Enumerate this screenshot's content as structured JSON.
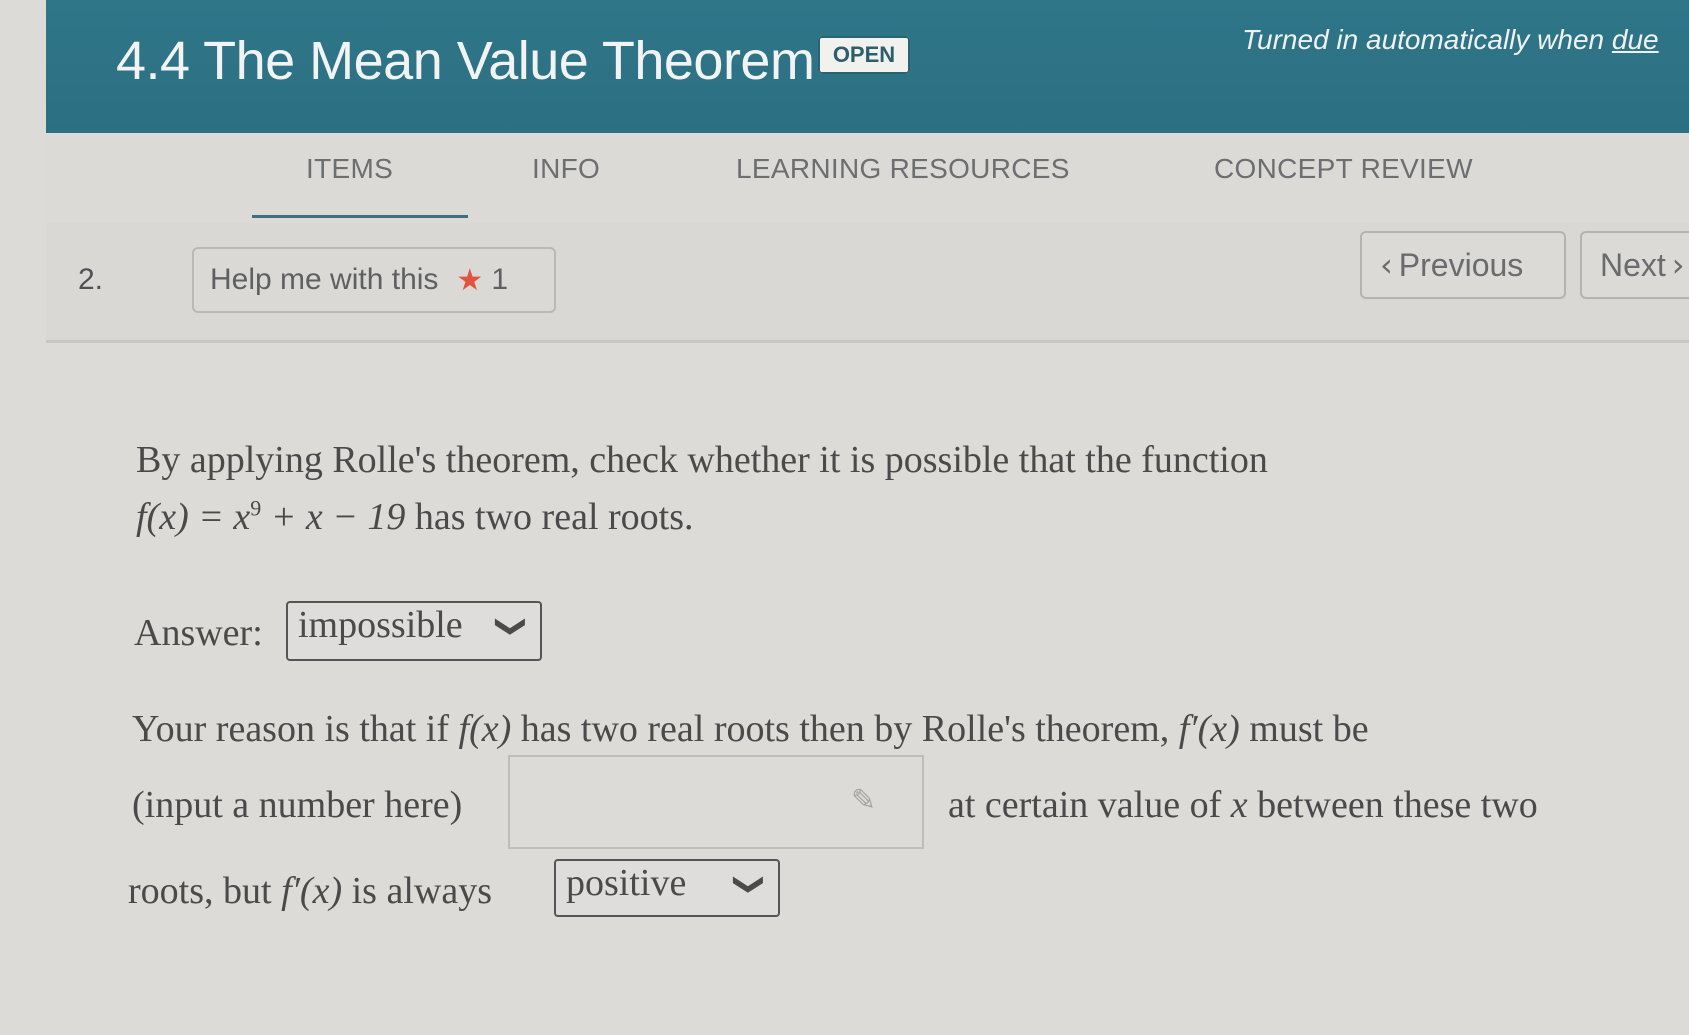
{
  "header": {
    "title": "4.4 The Mean Value Theorem",
    "badge": "OPEN",
    "turned_in_prefix": "Turned in automatically when ",
    "turned_in_link": "due"
  },
  "tabs": [
    {
      "label": "ITEMS",
      "active": true
    },
    {
      "label": "INFO",
      "active": false
    },
    {
      "label": "LEARNING RESOURCES",
      "active": false
    },
    {
      "label": "CONCEPT REVIEW",
      "active": false
    }
  ],
  "question": {
    "number": "2.",
    "help_label": "Help me with this",
    "help_count": "1",
    "prev_label": "Previous",
    "next_label": "Next"
  },
  "problem": {
    "line1": "By applying Rolle's theorem, check whether it is possible that the function",
    "func_lhs": "f(x) = x",
    "func_exp": "9",
    "func_rhs": " + x − 19",
    "line2_tail": " has two real roots.",
    "answer_label": "Answer:",
    "answer_value": "impossible",
    "reason_a": "Your reason is that if ",
    "fx": "f(x)",
    "reason_b": " has two real roots then by Rolle's theorem, ",
    "fpx": "f′(x)",
    "reason_c": " must be",
    "input_label": "(input a number here)",
    "number_value": "",
    "reason_d": "at certain value of ",
    "x": "x",
    "reason_e": " between these two",
    "reason_f": "roots, but ",
    "reason_g": " is always",
    "always_value": "positive"
  },
  "colors": {
    "header_bg": "#2d7487",
    "star": "#e0553e"
  }
}
